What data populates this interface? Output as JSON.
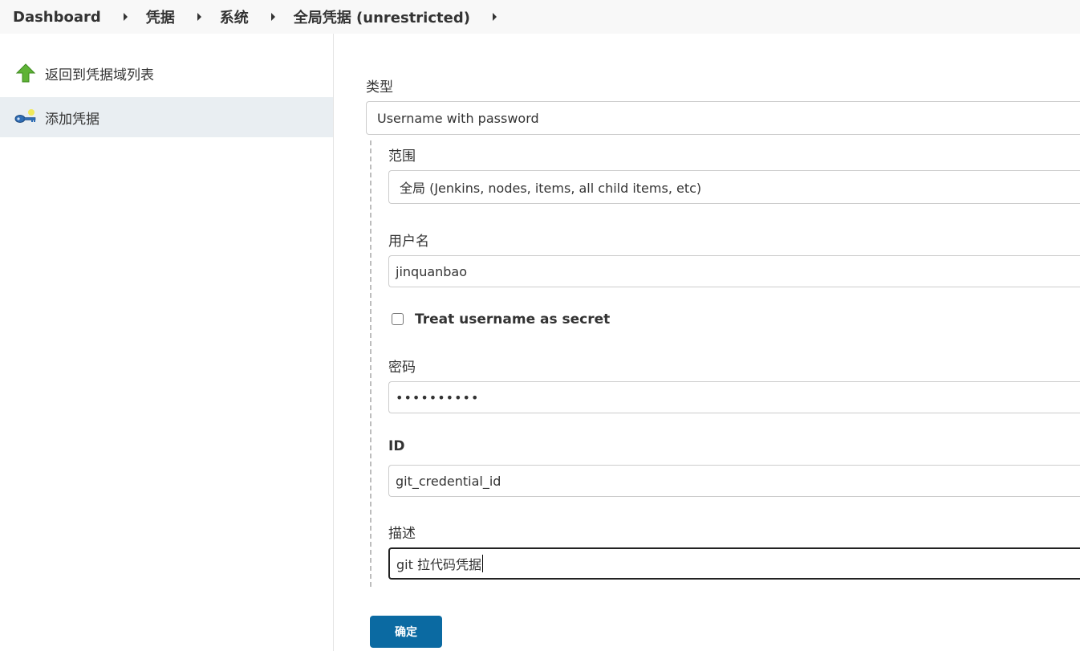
{
  "breadcrumb": {
    "items": [
      "Dashboard",
      "凭据",
      "系统",
      "全局凭据 (unrestricted)"
    ]
  },
  "sidebar": {
    "items": [
      {
        "label": "返回到凭据域列表",
        "icon": "up-arrow-icon"
      },
      {
        "label": "添加凭据",
        "icon": "key-icon"
      }
    ]
  },
  "form": {
    "kind_label": "类型",
    "kind_value": "Username with password",
    "scope_label": "范围",
    "scope_value": "全局 (Jenkins, nodes, items, all child items, etc)",
    "username_label": "用户名",
    "username_value": "jinquanbao",
    "treat_secret_label": "Treat username as secret",
    "treat_secret_checked": false,
    "password_label": "密码",
    "password_value": "••••••••••",
    "id_label": "ID",
    "id_value": "git_credential_id",
    "description_label": "描述",
    "description_value": "git 拉代码凭据",
    "submit_label": "确定"
  },
  "colors": {
    "breadcrumb_bg": "#f8f8f8",
    "sidebar_active": "#e9eef2",
    "submit": "#0b6aa2",
    "up_arrow": "#5fb336",
    "key": "#2f6db5"
  }
}
